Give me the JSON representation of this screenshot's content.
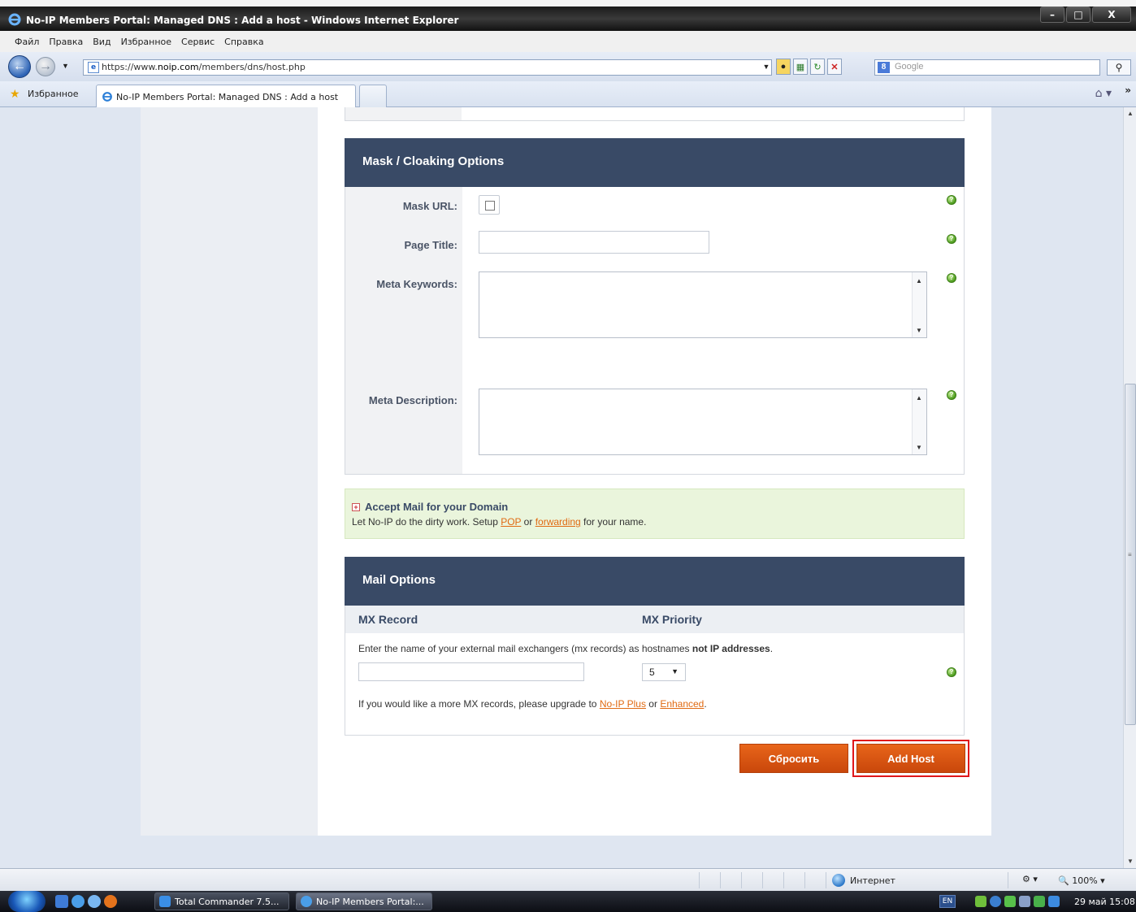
{
  "window": {
    "title": "No-IP Members Portal: Managed DNS : Add a host - Windows Internet Explorer",
    "minimize": "–",
    "maximize": "□",
    "close": "X"
  },
  "menu": [
    "Файл",
    "Правка",
    "Вид",
    "Избранное",
    "Сервис",
    "Справка"
  ],
  "address": {
    "protocol": "https://www.",
    "domain": "noip.com",
    "path": "/members/dns/host.php",
    "search_placeholder": "Google"
  },
  "favorites": {
    "label": "Избранное",
    "tab_title": "No-IP Members Portal: Managed DNS : Add a host"
  },
  "mask_section": {
    "title": "Mask / Cloaking Options",
    "mask_url_label": "Mask URL:",
    "page_title_label": "Page Title:",
    "meta_keywords_label": "Meta Keywords:",
    "meta_description_label": "Meta Description:",
    "page_title_value": "",
    "meta_keywords_value": "",
    "meta_description_value": ""
  },
  "mail_promo": {
    "title": "Accept Mail for your Domain",
    "text_before": "Let No-IP do the dirty work. Setup ",
    "pop_link": "POP",
    "text_middle": " or ",
    "forwarding_link": "forwarding",
    "text_after": " for your name."
  },
  "mail_section": {
    "title": "Mail Options",
    "col_mx_record": "MX Record",
    "col_mx_priority": "MX Priority",
    "instructions_before": "Enter the name of your external mail exchangers (mx records) as hostnames ",
    "instructions_bold": "not IP addresses",
    "instructions_after": ".",
    "mx_record_value": "",
    "mx_priority_value": "5",
    "upgrade_before": "If you would like a more MX records, please upgrade to ",
    "plus_link": "No-IP Plus",
    "upgrade_or": " or ",
    "enhanced_link": "Enhanced",
    "upgrade_after": "."
  },
  "buttons": {
    "reset": "Сбросить",
    "add_host": "Add Host"
  },
  "status": {
    "zone": "Интернет",
    "zoom": "100%"
  },
  "taskbar": {
    "task1": "Total Commander 7.5...",
    "task2": "No-IP Members Portal:...",
    "lang": "EN",
    "clock": "29 май 15:08"
  },
  "colors": {
    "section_header": "#394a66",
    "button_orange": "#d4540f",
    "highlight_red": "#e0161a",
    "link_orange": "#e06a12",
    "promo_bg": "#eaf5dc"
  }
}
